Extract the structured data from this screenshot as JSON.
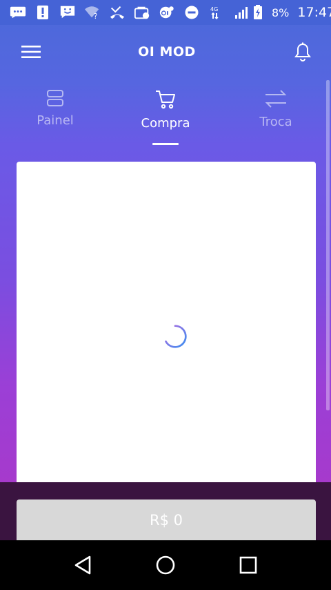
{
  "statusbar": {
    "battery": "8%",
    "time": "17:47",
    "network": "4G"
  },
  "appbar": {
    "title": "OI MOD"
  },
  "tabs": [
    {
      "label": "Painel",
      "icon": "server-icon",
      "active": false
    },
    {
      "label": "Compra",
      "icon": "cart-icon",
      "active": true
    },
    {
      "label": "Troca",
      "icon": "swap-arrows-icon",
      "active": false
    }
  ],
  "total": {
    "label": "R$ 0"
  },
  "colors": {
    "statusbar": "#4563d6",
    "gradient_top": "#4a6ad9",
    "gradient_bottom": "#a63acc",
    "bottom_panel": "#3a1440",
    "total_button": "#d8d8d8"
  }
}
